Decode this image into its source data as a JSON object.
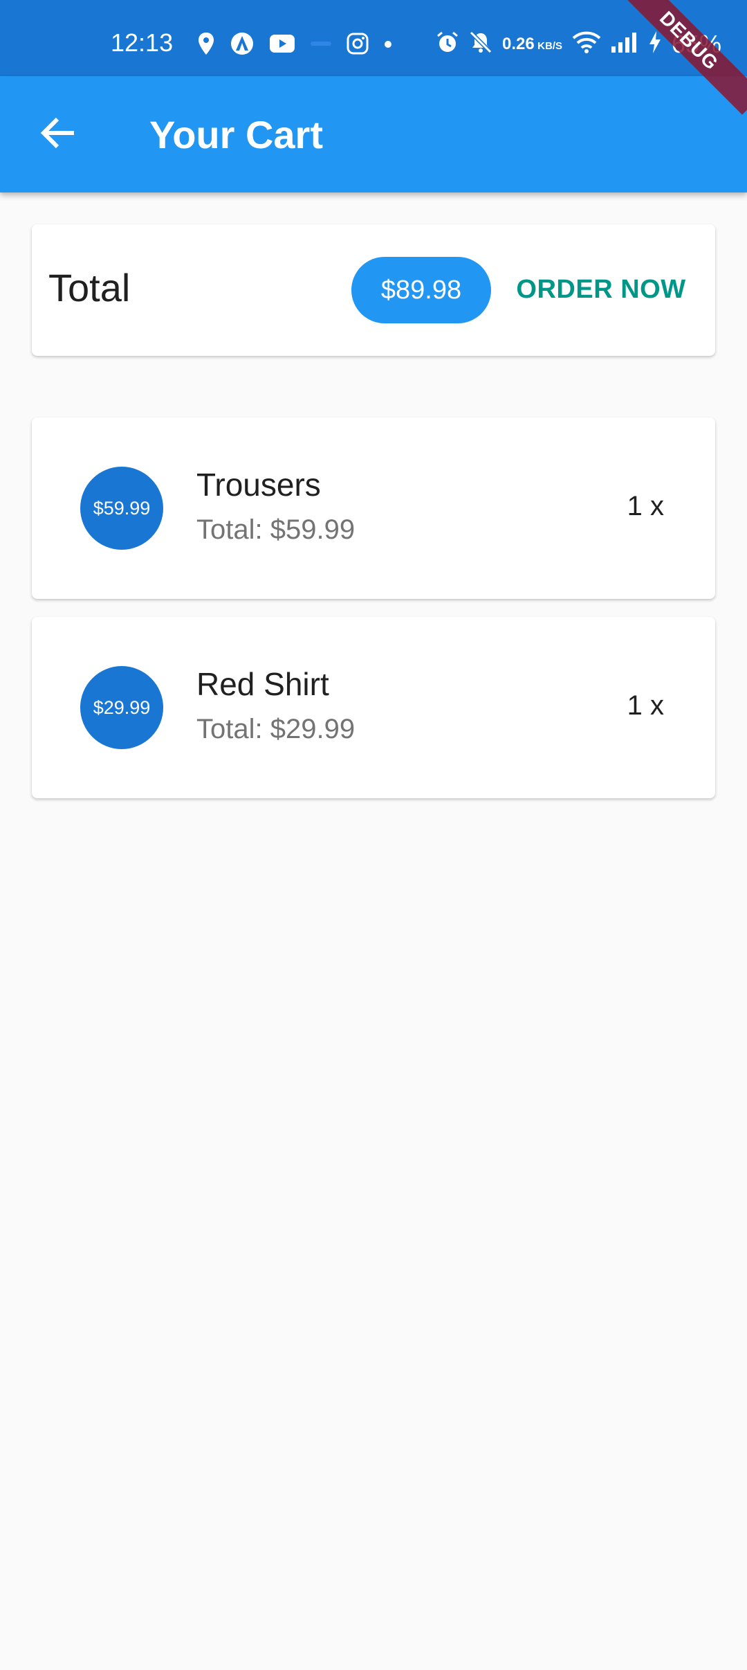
{
  "status_bar": {
    "time": "12:13",
    "speed_value": "0.26",
    "speed_unit": "KB/S",
    "battery": "65%"
  },
  "debug_banner": "DEBUG",
  "app_bar": {
    "title": "Your Cart",
    "back_icon": "arrow-back-icon"
  },
  "summary": {
    "label": "Total",
    "amount": "$89.98",
    "order_button": "ORDER NOW"
  },
  "cart_items": [
    {
      "avatar_price": "$59.99",
      "title": "Trousers",
      "subtitle": "Total: $59.99",
      "quantity": "1 x"
    },
    {
      "avatar_price": "$29.99",
      "title": "Red Shirt",
      "subtitle": "Total: $29.99",
      "quantity": "1 x"
    }
  ],
  "colors": {
    "status_bar": "#1976d2",
    "app_bar": "#2196f3",
    "accent": "#009688",
    "avatar": "#1976d2",
    "background": "#fafafa"
  }
}
